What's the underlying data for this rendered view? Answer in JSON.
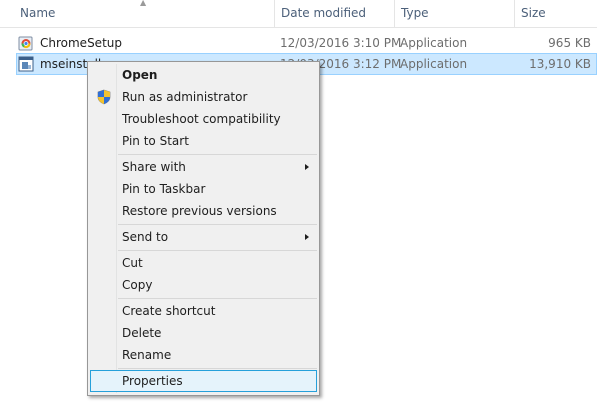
{
  "columns": {
    "name": "Name",
    "date_modified": "Date modified",
    "type": "Type",
    "size": "Size"
  },
  "files": [
    {
      "name": "ChromeSetup",
      "date": "12/03/2016 3:10 PM",
      "type": "Application",
      "size": "965 KB",
      "icon": "chrome-setup-icon"
    },
    {
      "name": "mseinstall",
      "date": "12/03/2016 3:12 PM",
      "type": "Application",
      "size": "13,910 KB",
      "icon": "installer-icon",
      "selected": true
    }
  ],
  "context_menu": {
    "open": "Open",
    "run_as_admin": "Run as administrator",
    "troubleshoot": "Troubleshoot compatibility",
    "pin_start": "Pin to Start",
    "share_with": "Share with",
    "pin_taskbar": "Pin to Taskbar",
    "restore_versions": "Restore previous versions",
    "send_to": "Send to",
    "cut": "Cut",
    "copy": "Copy",
    "create_shortcut": "Create shortcut",
    "delete": "Delete",
    "rename": "Rename",
    "properties": "Properties"
  },
  "colors": {
    "selection": "#cce8ff",
    "hover_border": "#26a0da",
    "menu_background": "#f0f0f0"
  }
}
